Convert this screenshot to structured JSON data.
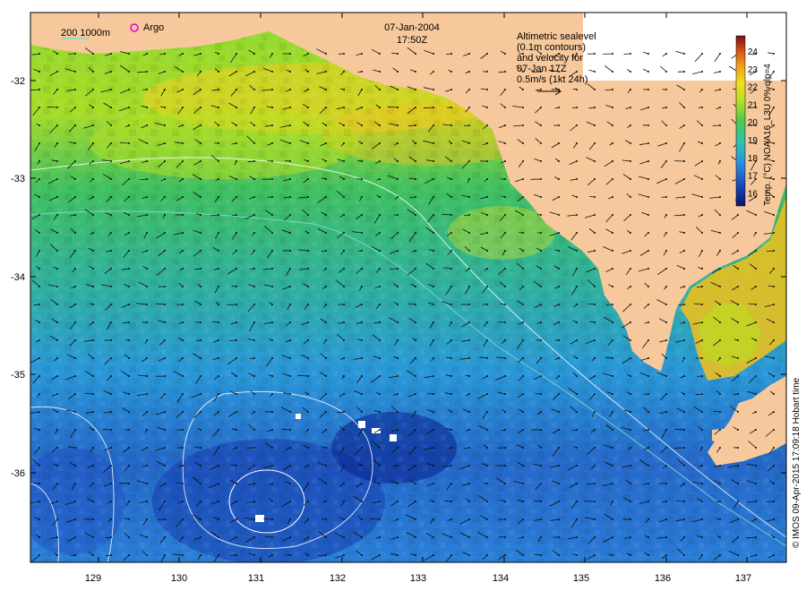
{
  "header": {
    "date": "07-Jan-2004",
    "time": "17:50Z"
  },
  "legend": {
    "scale_label": "200  1000m",
    "argo_label": "Argo",
    "argo_color": "#e000e0",
    "isobath_color": "#7fd8d0"
  },
  "altimetry_note": {
    "lines": [
      "Altimetric sealevel",
      "(0.1m contours)",
      "and velocity for",
      "07-Jan 17Z",
      "0.5m/s (1kt 24h)"
    ]
  },
  "colorbar": {
    "title": "Temp. (°C) NOAA16_L3U 0% qlp=4",
    "ticks": [
      "24",
      "23",
      "22",
      "21",
      "20",
      "19",
      "18",
      "17",
      "16"
    ],
    "colors": [
      "#7a1010",
      "#c0300a",
      "#e8601a",
      "#f0a020",
      "#f0e020",
      "#b8e020",
      "#60c840",
      "#30c090",
      "#30a0e0",
      "#2060c0",
      "#1030a0",
      "#0a1470"
    ]
  },
  "axes": {
    "x_ticks": [
      "129",
      "130",
      "131",
      "132",
      "133",
      "134",
      "135",
      "136",
      "137"
    ],
    "y_ticks": [
      "-32",
      "-33",
      "-34",
      "-35",
      "-36"
    ]
  },
  "credit": "© IMOS 09-Apr-2015 17:09:18 Hobart time",
  "colors": {
    "land": "#f7c89b",
    "frame": "#000000",
    "contour": "#ffffff"
  }
}
